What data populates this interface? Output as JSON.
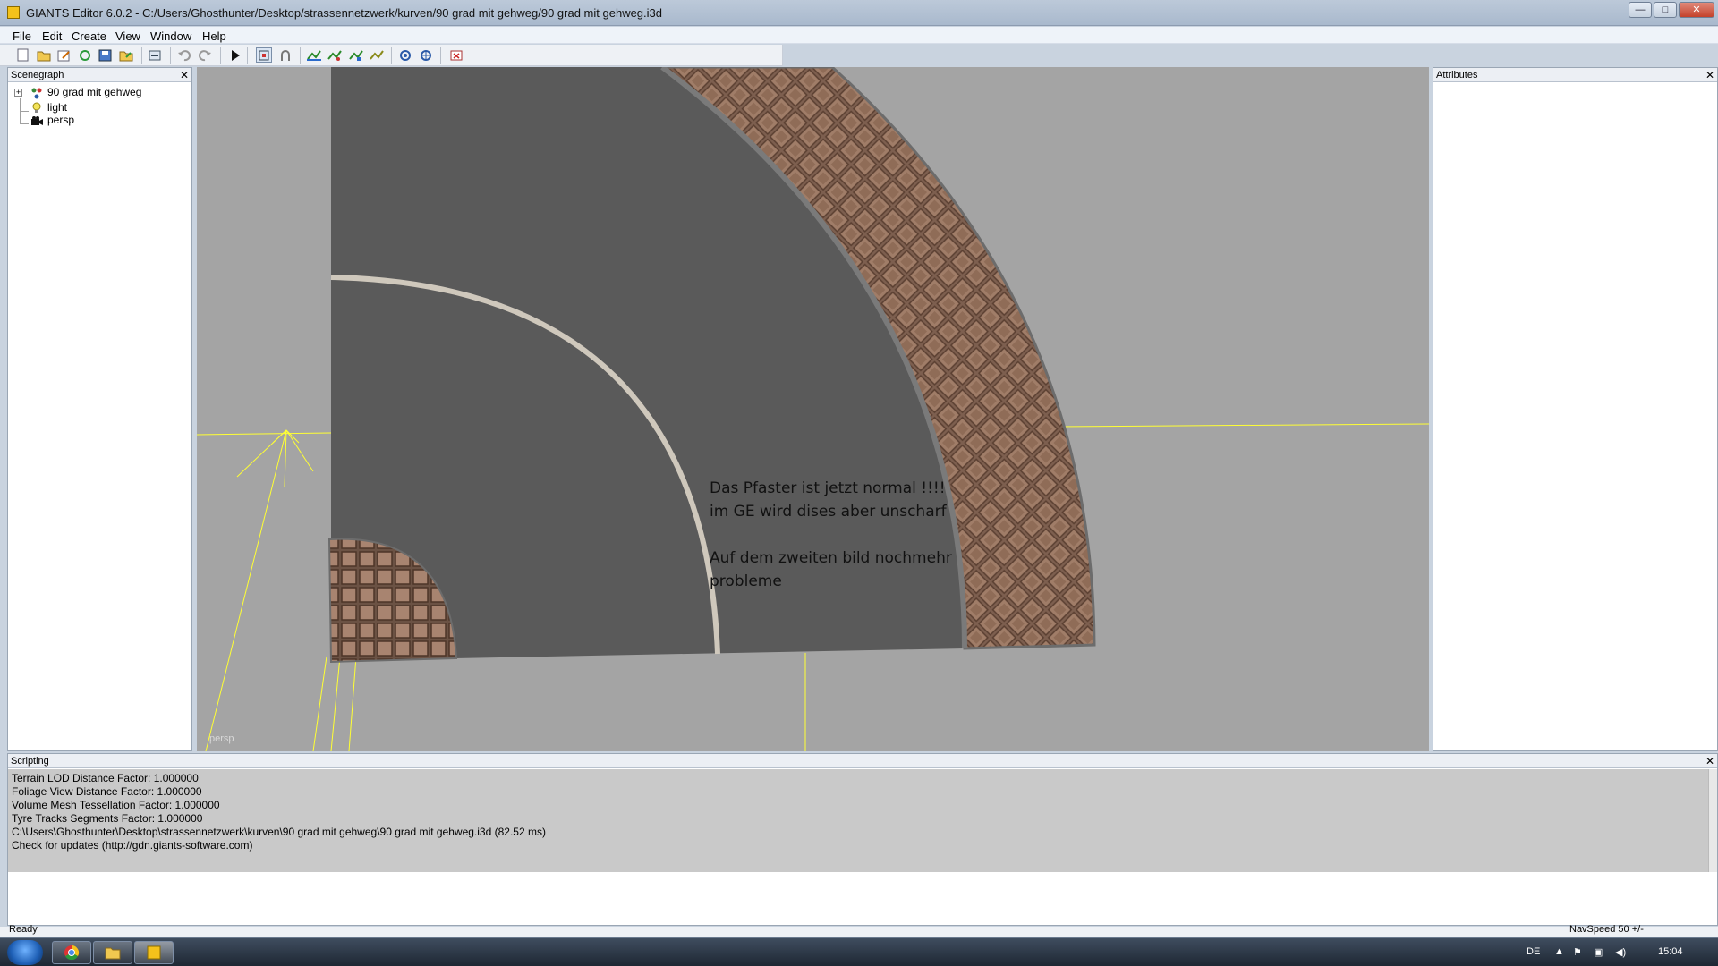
{
  "window": {
    "title": "GIANTS Editor 6.0.2 - C:/Users/Ghosthunter/Desktop/strassennetzwerk/kurven/90 grad mit gehweg/90 grad mit gehweg.i3d",
    "minimize": "—",
    "maximize": "□",
    "close": "✕"
  },
  "menu": [
    "File",
    "Edit",
    "Create",
    "View",
    "Window",
    "Help"
  ],
  "toolbar": {
    "icons": [
      "new-icon",
      "open-icon",
      "edit-icon",
      "refresh-icon",
      "save-icon",
      "export-icon",
      "import-icon",
      "undo-icon",
      "redo-icon",
      "play-icon",
      "select-icon",
      "magnet-icon",
      "move-icon",
      "rotate-icon",
      "scale-icon",
      "snap-icon",
      "cycle-icon",
      "settings-icon",
      "delete-icon"
    ]
  },
  "scenegraph": {
    "title": "Scenegraph",
    "close": "✕",
    "expand": "+",
    "items": [
      "90 grad mit gehweg",
      "light",
      "persp"
    ]
  },
  "viewport": {
    "note": "Das Pfaster ist jetzt normal !!!!\nim GE wird dises aber unscharf\n\nAuf dem zweiten bild nochmehr\nprobleme",
    "camera_label": "persp"
  },
  "attributes": {
    "title": "Attributes",
    "close": "✕"
  },
  "scripting": {
    "title": "Scripting",
    "close": "✕",
    "lines": [
      " Terrain LOD Distance Factor: 1.000000",
      " Foliage View Distance Factor: 1.000000",
      " Volume Mesh Tessellation Factor: 1.000000",
      " Tyre Tracks Segments Factor: 1.000000",
      "C:\\Users\\Ghosthunter\\Desktop\\strassennetzwerk\\kurven\\90 grad mit gehweg\\90 grad mit gehweg.i3d (82.52 ms)",
      "Check for updates (http://gdn.giants-software.com)"
    ]
  },
  "statusbar": {
    "left": "Ready",
    "right": "NavSpeed 50 +/-"
  },
  "taskbar": {
    "apps": [
      "chrome-icon",
      "explorer-icon",
      "giants-editor-icon"
    ],
    "language": "DE",
    "time": "15:04"
  },
  "colors": {
    "viewport_bg": "#a4a4a4",
    "asphalt": "#5a5a5a",
    "lane_line": "#cfc8bc",
    "paving": "#8a6a58",
    "gizmo": "#ffff33"
  }
}
